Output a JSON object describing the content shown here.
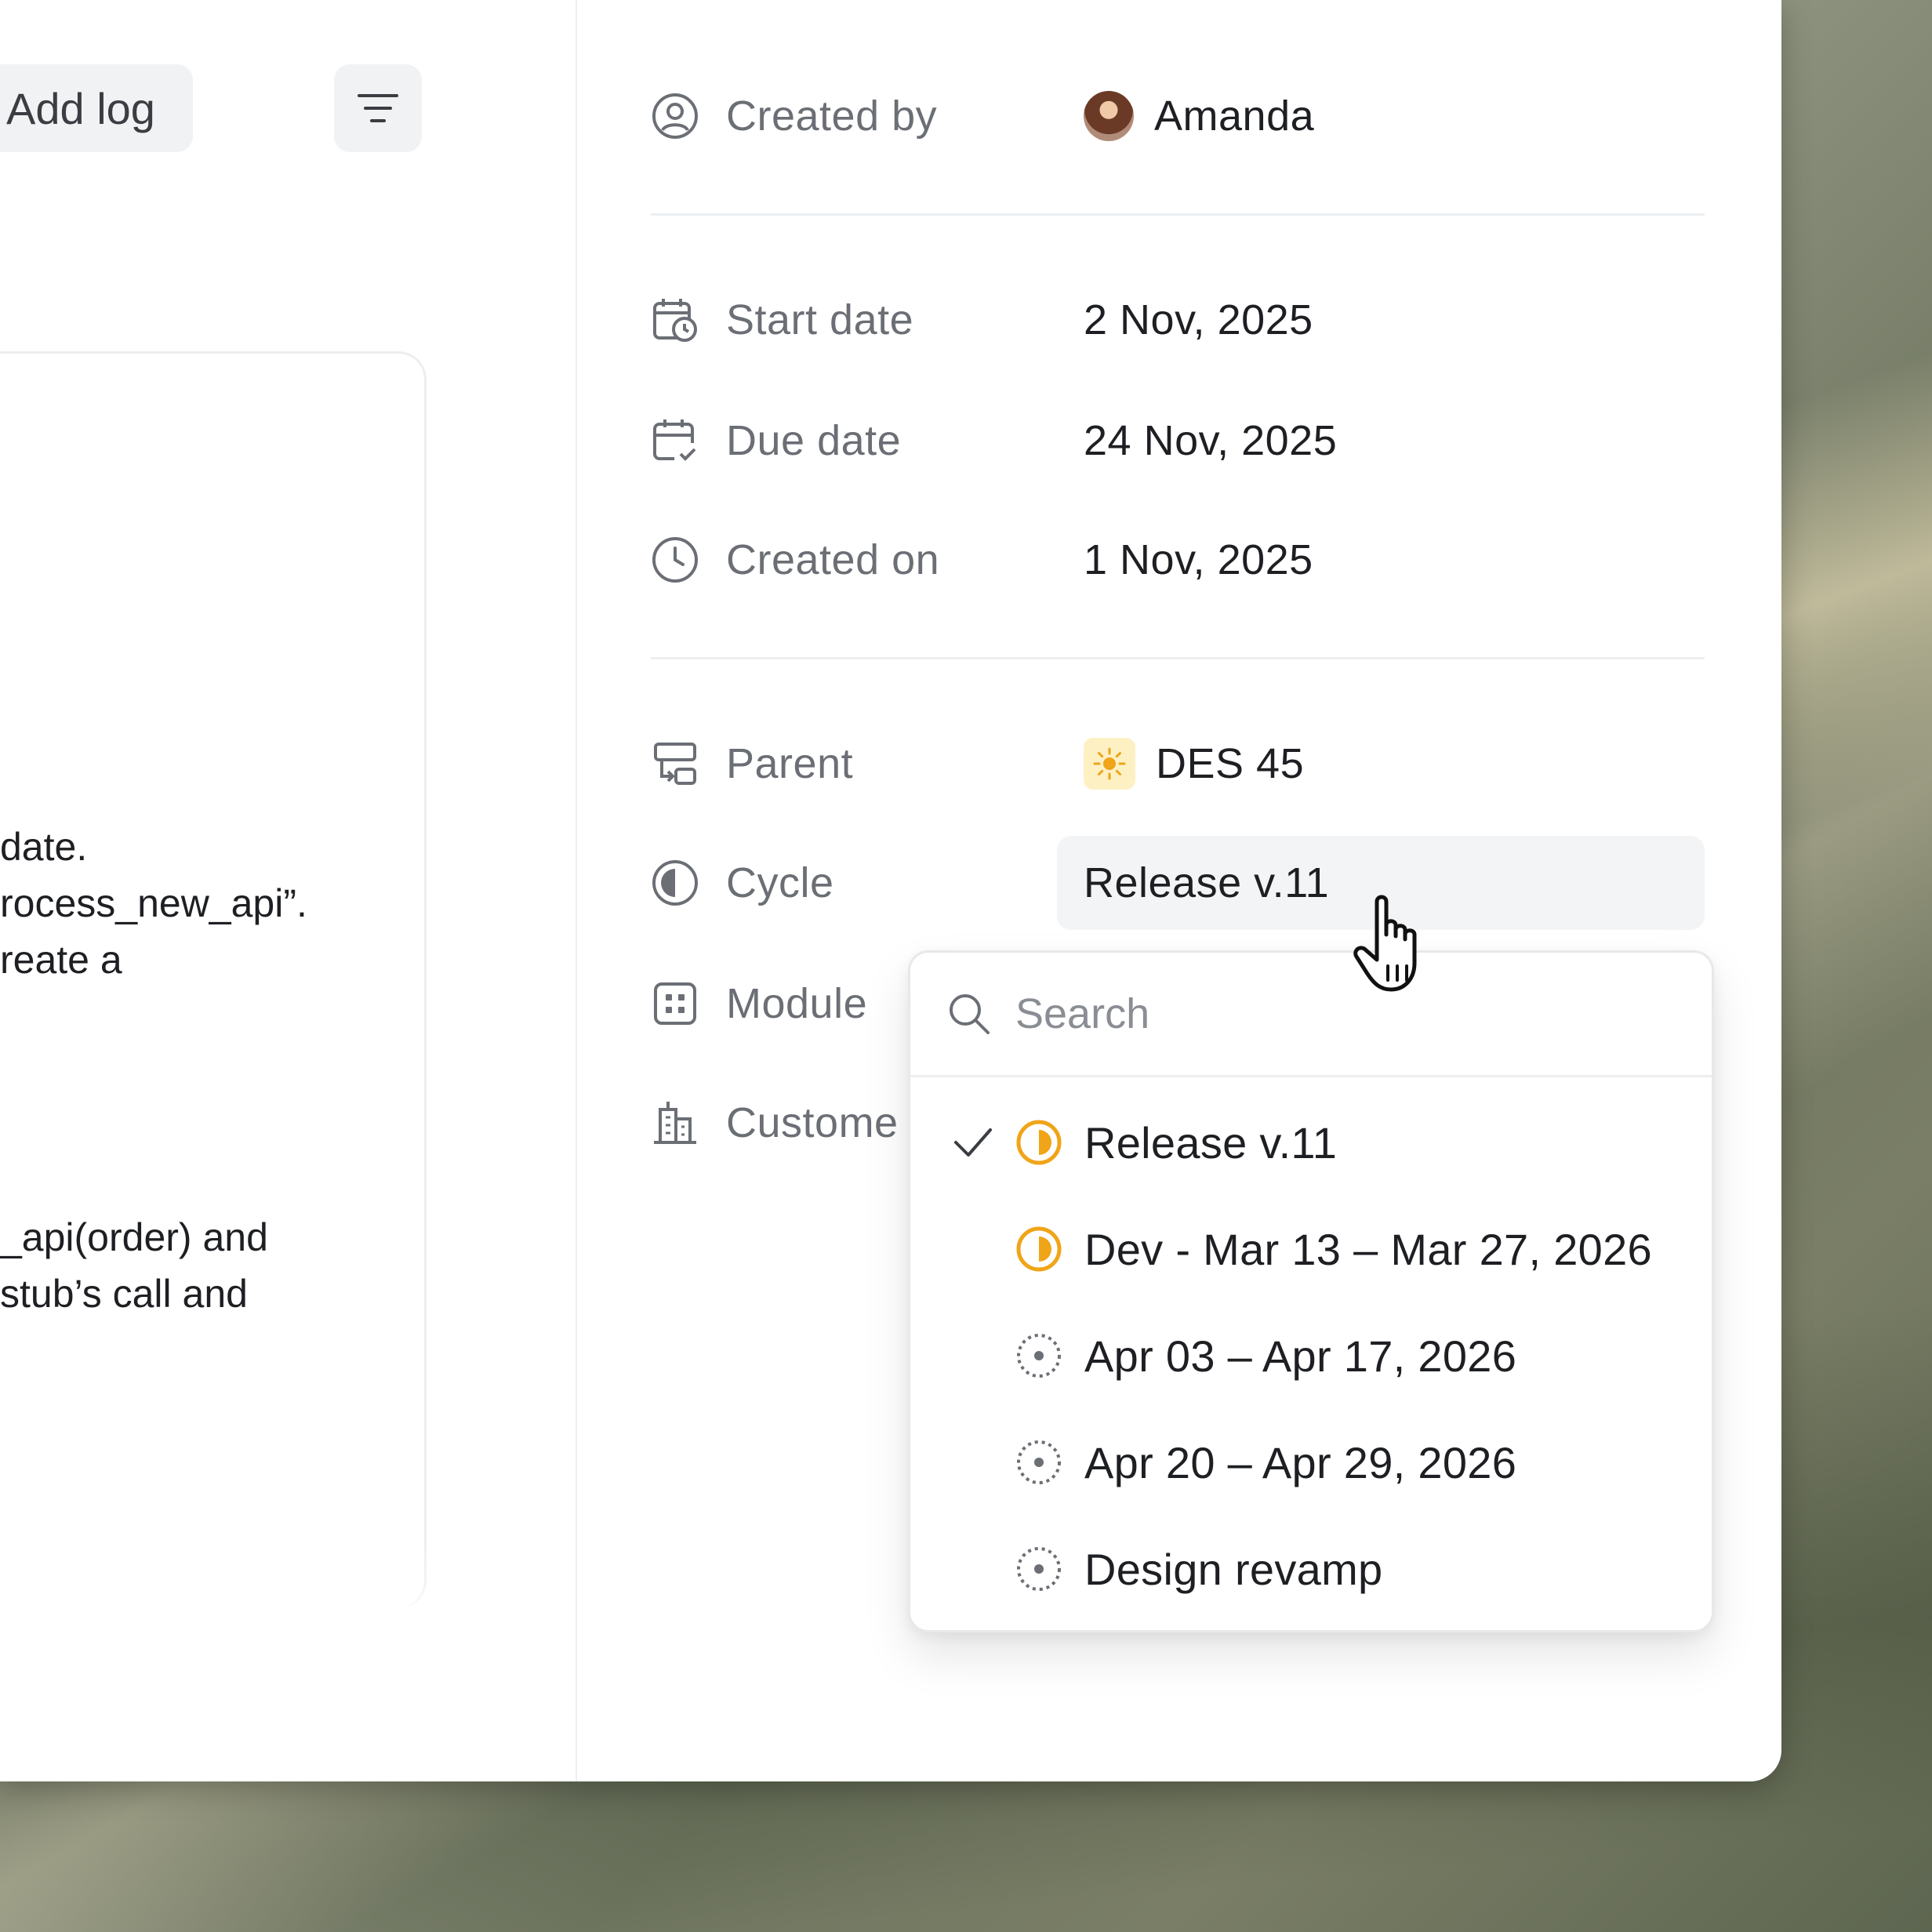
{
  "toolbar": {
    "add_log_label": "Add log"
  },
  "activity_snippets": [
    "date.",
    "rocess_new_api”.",
    "reate a",
    "_api(order) and",
    "stub’s call and"
  ],
  "properties": {
    "created_by": {
      "label": "Created by",
      "value": "Amanda"
    },
    "start_date": {
      "label": "Start date",
      "value": "2 Nov, 2025"
    },
    "due_date": {
      "label": "Due date",
      "value": "24 Nov, 2025"
    },
    "created_on": {
      "label": "Created on",
      "value": "1 Nov, 2025"
    },
    "parent": {
      "label": "Parent",
      "value": "DES 45"
    },
    "cycle": {
      "label": "Cycle",
      "value": "Release v.11"
    },
    "module": {
      "label": "Module"
    },
    "customer": {
      "label": "Custome"
    }
  },
  "cycle_dropdown": {
    "search_placeholder": "Search",
    "options": [
      {
        "label": "Release v.11",
        "selected": true,
        "status": "in-progress"
      },
      {
        "label": "Dev - Mar 13 – Mar 27, 2026",
        "selected": false,
        "status": "in-progress"
      },
      {
        "label": "Apr 03 – Apr 17, 2026",
        "selected": false,
        "status": "upcoming"
      },
      {
        "label": "Apr 20 – Apr 29, 2026",
        "selected": false,
        "status": "upcoming"
      },
      {
        "label": "Design revamp",
        "selected": false,
        "status": "upcoming"
      }
    ]
  },
  "colors": {
    "accent_orange": "#f0a418",
    "muted_text": "#6b6f75",
    "primary_text": "#1d1f23"
  }
}
